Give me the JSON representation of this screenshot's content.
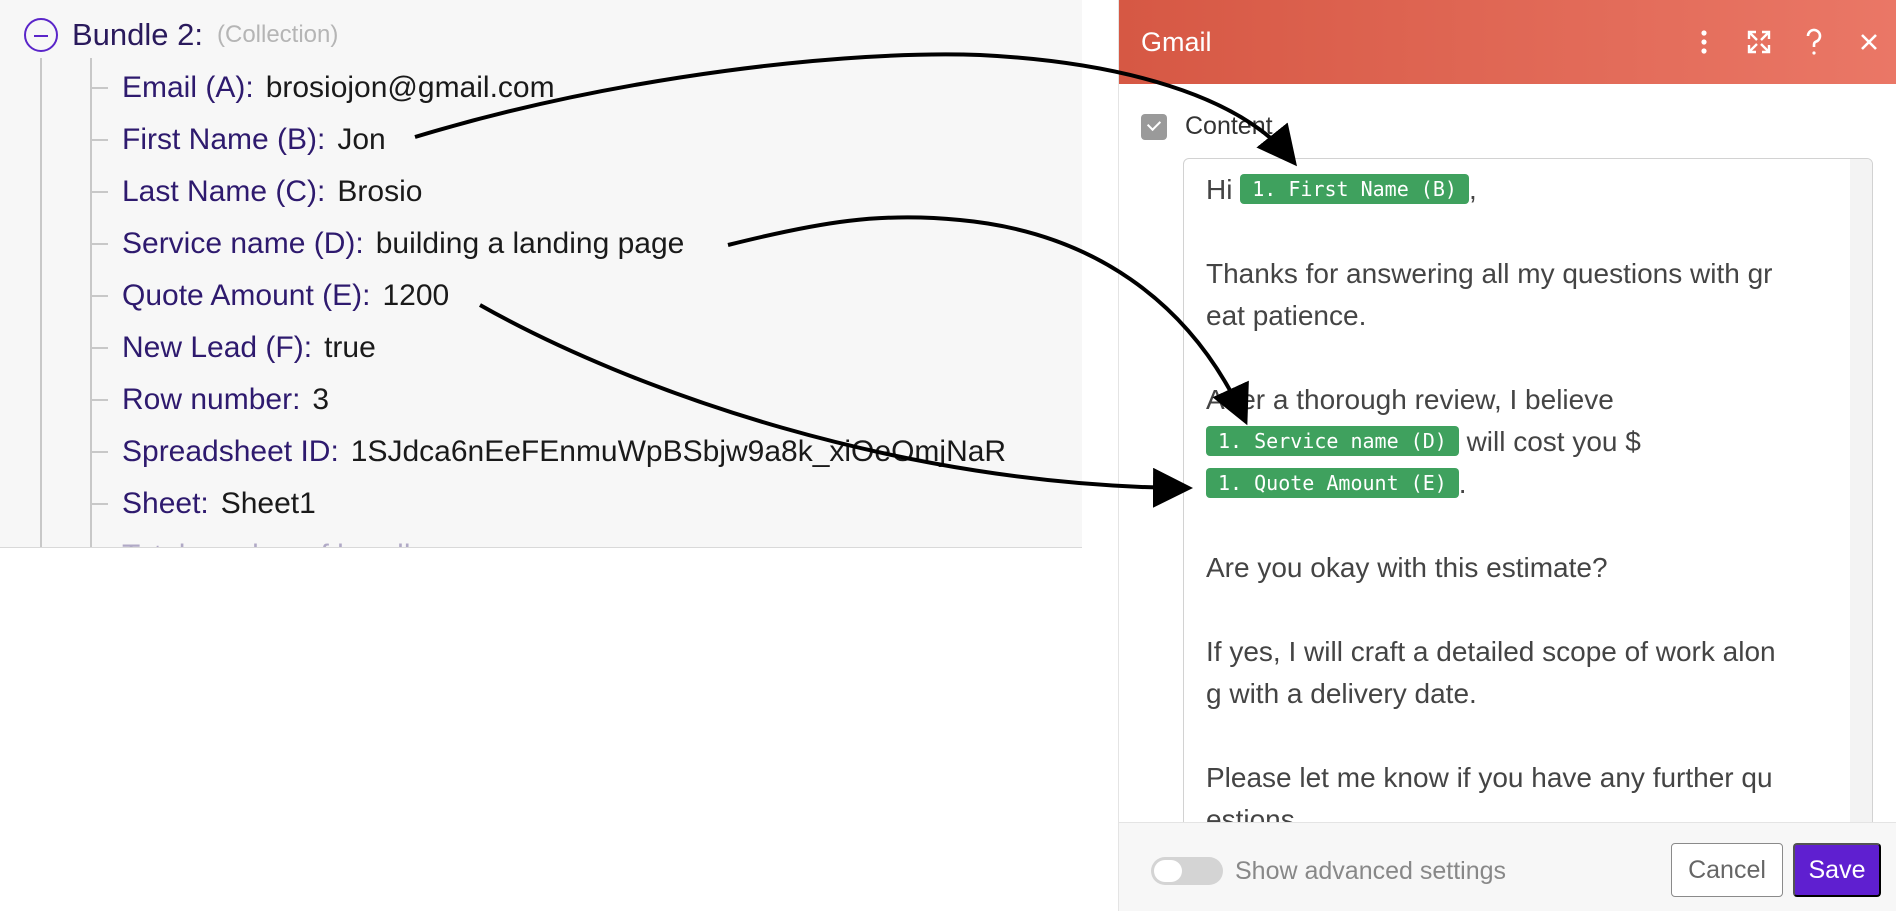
{
  "bundle": {
    "title": "Bundle 2:",
    "type_label": "(Collection)",
    "fields": [
      {
        "key": "Email (A):",
        "value": "brosiojon@gmail.com"
      },
      {
        "key": "First Name (B):",
        "value": "Jon"
      },
      {
        "key": "Last Name (C):",
        "value": "Brosio"
      },
      {
        "key": "Service name (D):",
        "value": "building a landing page"
      },
      {
        "key": "Quote Amount (E):",
        "value": "1200"
      },
      {
        "key": "New Lead (F):",
        "value": "true"
      },
      {
        "key": "Row number:",
        "value": "3"
      },
      {
        "key": "Spreadsheet ID:",
        "value": "1SJdca6nEeFEnmuWpBSbjw9a8k_xiOeOmjNaR"
      },
      {
        "key": "Sheet:",
        "value": "Sheet1"
      }
    ],
    "partial_row": "Total number of bundles"
  },
  "gmail": {
    "title": "Gmail",
    "header_icons": {
      "more": "more-vertical-icon",
      "expand": "expand-icon",
      "help": "help-icon",
      "close": "close-icon"
    },
    "content_label": "Content",
    "editor": {
      "greeting": "Hi",
      "pill_first_name": "1. First Name (B)",
      "greeting_end": ",",
      "line_thanks_1": "Thanks for answering all my questions with gr",
      "line_thanks_2": "eat patience.",
      "line_review": "After a thorough review, I believe",
      "pill_service": "1. Service name (D)",
      "line_cost": "will cost you $",
      "pill_quote": "1. Quote Amount (E)",
      "line_period": ".",
      "line_question": "Are you okay with this estimate?",
      "line_yes_1": "If yes, I will craft a detailed scope of work alon",
      "line_yes_2": "g with a delivery date.",
      "line_further_1": "Please let me know if you have any further qu",
      "line_further_2": "estions."
    },
    "footer": {
      "toggle_label": "Show advanced settings",
      "cancel": "Cancel",
      "save": "Save"
    }
  },
  "colors": {
    "header_start": "#d65844",
    "header_end": "#ea7766",
    "pill": "#3fa15e",
    "save": "#5f1fd0",
    "field_key": "#2e1a6e"
  }
}
